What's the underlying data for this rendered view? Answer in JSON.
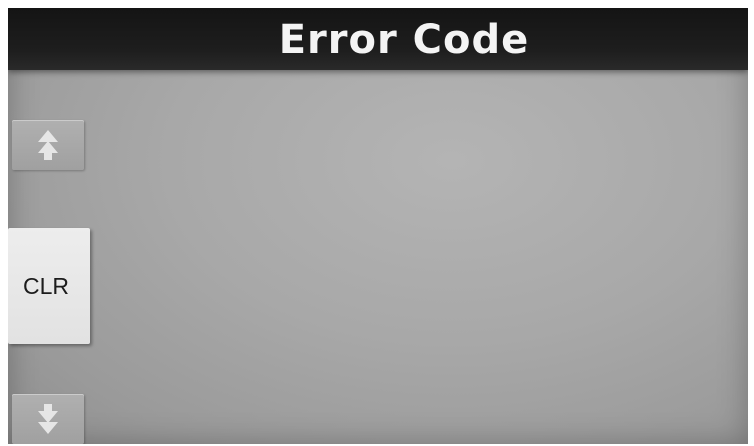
{
  "header": {
    "title": "Error Code"
  },
  "sidebar": {
    "scroll_up_icon": "double-up-arrow",
    "clear_label": "CLR",
    "scroll_down_icon": "double-down-arrow"
  },
  "colors": {
    "title_bar": "#1a1a1a",
    "title_text": "#f4f4f4",
    "background": "#a8a8a8",
    "button": "#a6a6a6",
    "clear_button": "#e6e6e6"
  }
}
